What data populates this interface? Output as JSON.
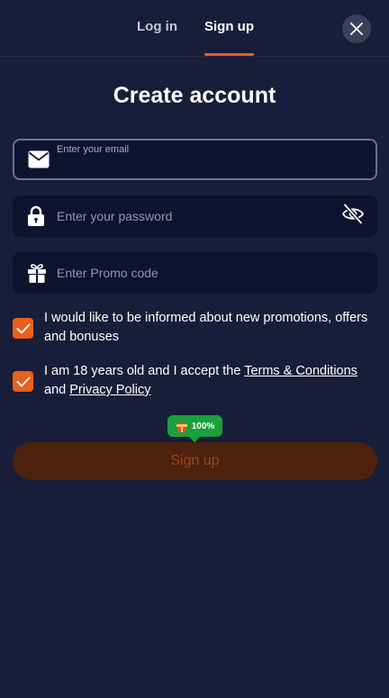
{
  "tabs": {
    "login": "Log in",
    "signup": "Sign up"
  },
  "title": "Create account",
  "email": {
    "placeholder": "Enter your email"
  },
  "password": {
    "placeholder": "Enter your password"
  },
  "promo": {
    "placeholder": "Enter Promo code"
  },
  "consent_promotions": {
    "text": "I would like to be informed about new promotions, offers and bonuses",
    "checked": true
  },
  "consent_terms": {
    "prefix": "I am 18 years old and I accept the ",
    "terms_link": "Terms & Conditions",
    "middle": " and ",
    "privacy_link": "Privacy Policy",
    "checked": true
  },
  "bonus_badge": {
    "percent": "100%"
  },
  "submit": {
    "label": "Sign up"
  },
  "colors": {
    "background": "#181e39",
    "field": "#0e1430",
    "accent": "#e8601a",
    "submit_disabled": "#4c220c",
    "badge": "#19a13c"
  },
  "icons": {
    "close": "close-icon",
    "email": "envelope-icon",
    "password": "lock-icon",
    "visibility": "eye-off-icon",
    "promo": "gift-icon",
    "check": "check-icon",
    "badge": "gift-box-icon"
  }
}
